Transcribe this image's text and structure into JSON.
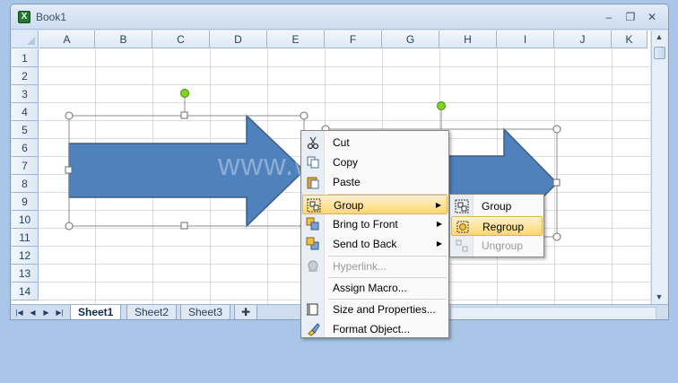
{
  "window": {
    "title": "Book1",
    "app_icon": "X"
  },
  "columns": [
    "A",
    "B",
    "C",
    "D",
    "E",
    "F",
    "G",
    "H",
    "I",
    "J",
    "K"
  ],
  "rows": [
    "1",
    "2",
    "3",
    "4",
    "5",
    "6",
    "7",
    "8",
    "9",
    "10",
    "11",
    "12",
    "13",
    "14"
  ],
  "watermark": "www.w3s.com",
  "sheet_tabs": [
    {
      "label": "Sheet1",
      "active": true
    },
    {
      "label": "Sheet2",
      "active": false
    },
    {
      "label": "Sheet3",
      "active": false
    }
  ],
  "context_menu": {
    "cut": "Cut",
    "copy": "Copy",
    "paste": "Paste",
    "group": "Group",
    "bring_to_front": "Bring to Front",
    "send_to_back": "Send to Back",
    "hyperlink": "Hyperlink...",
    "assign_macro": "Assign Macro...",
    "size_properties": "Size and Properties...",
    "format_object": "Format Object..."
  },
  "group_submenu": {
    "group": "Group",
    "regroup": "Regroup",
    "ungroup": "Ungroup"
  },
  "colors": {
    "arrow_fill": "#4f81bd",
    "arrow_stroke": "#385d8a",
    "handle_green": "#7ed321",
    "menu_highlight": "#ffd776"
  }
}
